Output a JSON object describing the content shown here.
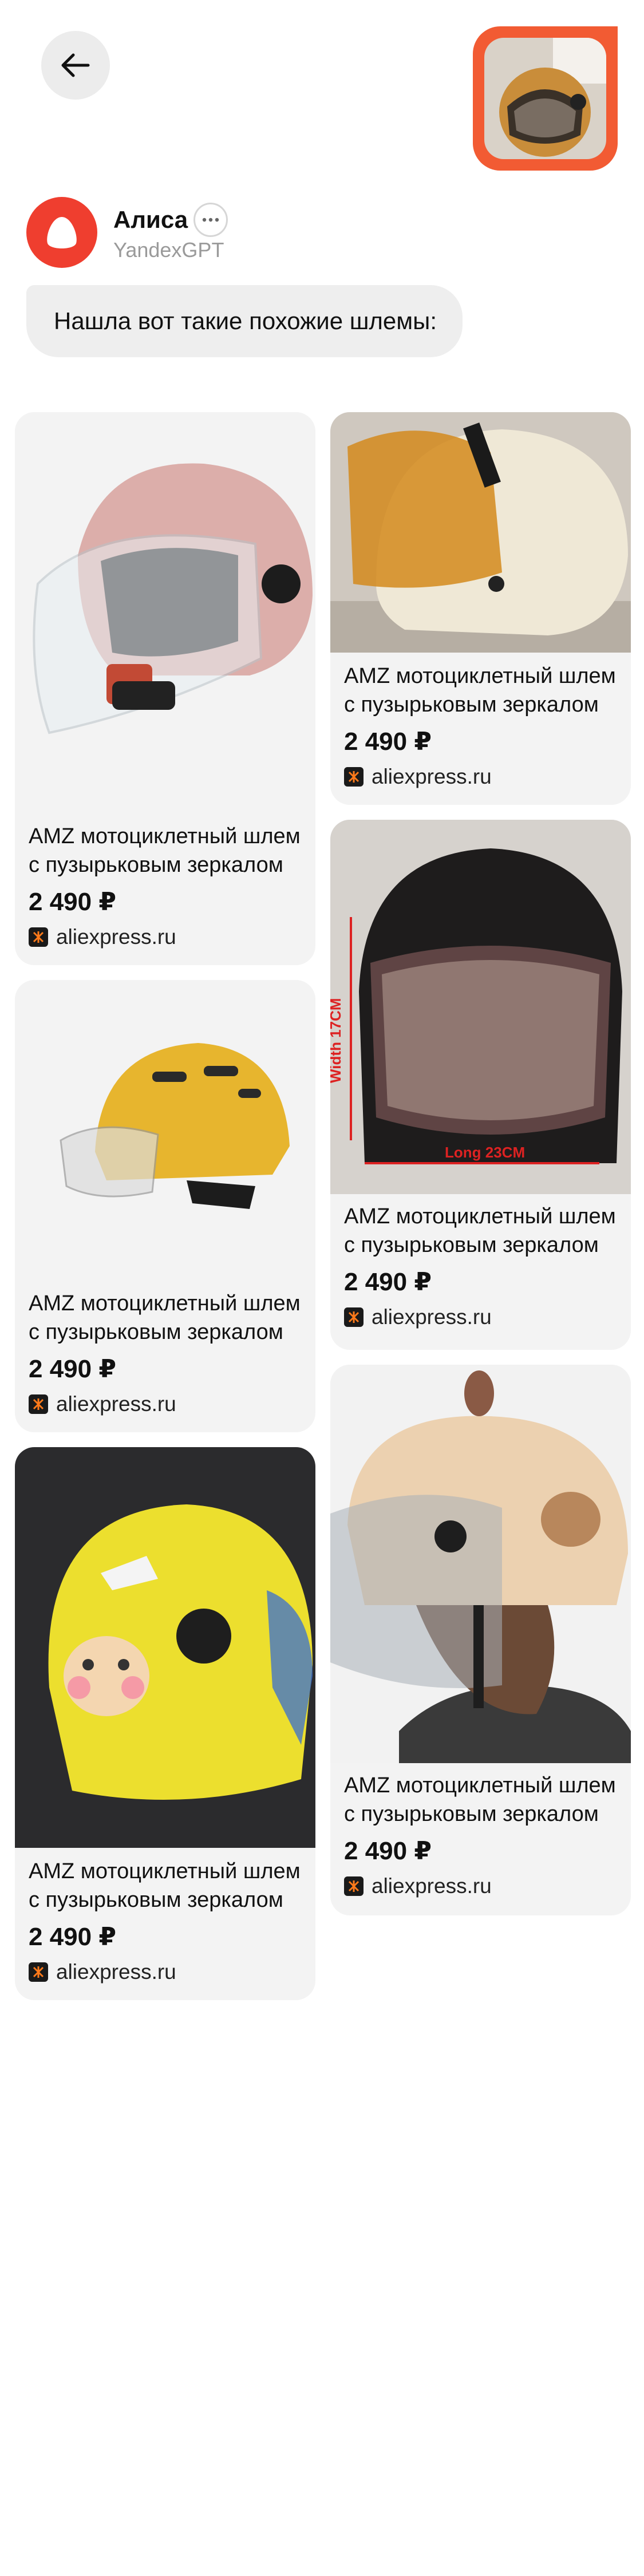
{
  "header": {
    "back_icon": "arrow-left-icon"
  },
  "assistant": {
    "name": "Алиса",
    "subtitle": "YandexGPT",
    "more_icon": "more-dots-icon"
  },
  "message": {
    "text": "Нашла вот такие похожие шлемы:"
  },
  "products": [
    {
      "title": "AMZ мотоциклетный шлем с пузырьковым зеркалом",
      "price": "2 490 ₽",
      "source": "aliexpress.ru"
    },
    {
      "title": "AMZ мотоциклетный шлем с пузырьковым зеркалом",
      "price": "2 490 ₽",
      "source": "aliexpress.ru"
    },
    {
      "title": "AMZ мотоциклетный шлем с пузырьковым зеркалом",
      "price": "2 490 ₽",
      "source": "aliexpress.ru"
    },
    {
      "title": "AMZ мотоциклетный шлем с пузырьковым зеркалом",
      "price": "2 490 ₽",
      "source": "aliexpress.ru"
    },
    {
      "title": "AMZ мотоциклетный шлем с пузырьковым зеркалом",
      "price": "2 490 ₽",
      "source": "aliexpress.ru"
    },
    {
      "title": "AMZ мотоциклетный шлем с пузырьковым зеркалом",
      "price": "2 490 ₽",
      "source": "aliexpress.ru"
    }
  ],
  "image_labels": {
    "width": "Width 17CM",
    "length": "Long 23CM"
  },
  "colors": {
    "accent": "#f25b33",
    "alice": "#ef3e2f",
    "card_bg": "#f3f3f3"
  }
}
